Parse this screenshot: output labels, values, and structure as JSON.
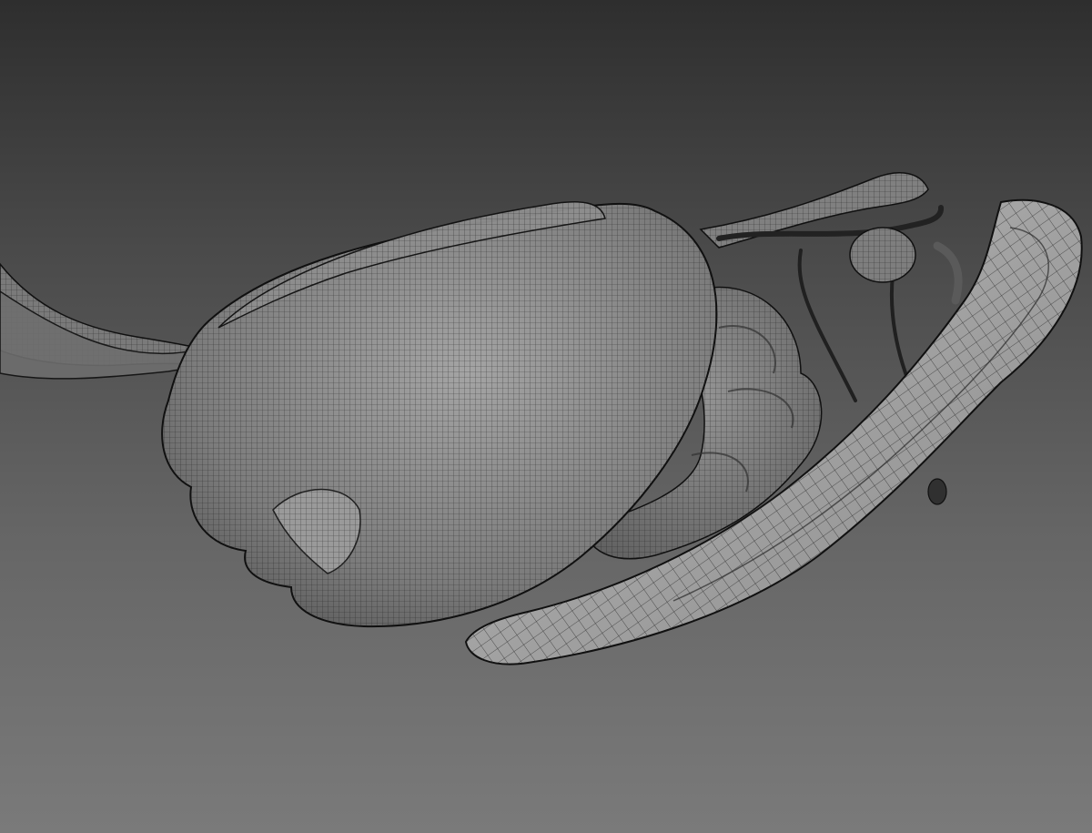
{
  "viewport": {
    "background_top": "#2e2e2e",
    "background_bottom": "#7a7a7a"
  },
  "meshes": [
    {
      "name": "stomach",
      "color": "#8a8a8a"
    },
    {
      "name": "pancreas",
      "color": "#9c9c9c"
    },
    {
      "name": "intestine-coils",
      "color": "#858585"
    },
    {
      "name": "gallbladder",
      "color": "#7e7e7e"
    },
    {
      "name": "vessels",
      "color": "#6e6e6e"
    }
  ],
  "wire_color": "#1c1c1c",
  "outline_color": "#101010"
}
